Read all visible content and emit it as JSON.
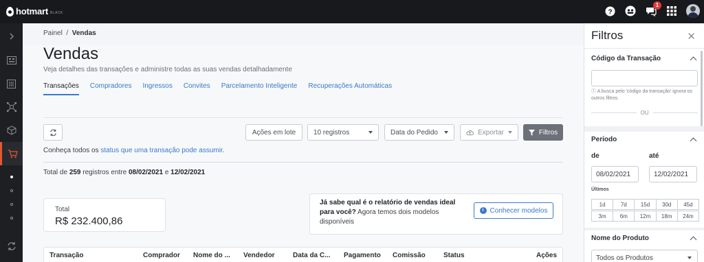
{
  "brand": {
    "name": "hotmart",
    "sub": "BLACK"
  },
  "topbar": {
    "notifications_count": "1"
  },
  "breadcrumb": {
    "root": "Painel",
    "current": "Vendas"
  },
  "page": {
    "title": "Vendas",
    "subtitle": "Veja detalhes das transações e administre todas as suas vendas detalhadamente"
  },
  "tabs": [
    "Transações",
    "Compradores",
    "Ingressos",
    "Convites",
    "Parcelamento Inteligente",
    "Recuperações Automáticas"
  ],
  "toolbar": {
    "bulk_actions": "Ações em lote",
    "per_page": "10 registros",
    "date_type": "Data do Pedido",
    "export": "Exportar",
    "filters": "Filtros"
  },
  "info": {
    "prefix": "Conheça todos os ",
    "link": "status que uma transação pode assumir",
    "suffix": "."
  },
  "summary": {
    "prefix": "Total de ",
    "count": "259",
    "middle": " registros entre ",
    "start": "08/02/2021",
    "and": " e ",
    "end": "12/02/2021"
  },
  "total_card": {
    "label": "Total",
    "value": "R$ 232.400,86"
  },
  "promo": {
    "bold": "Já sabe qual é o relatório de vendas ideal para você?",
    "text": " Agora temos dois modelos disponíveis",
    "button": "Conhecer modelos"
  },
  "table": {
    "columns": [
      "Transação",
      "Comprador",
      "Nome do ...",
      "Vendedor",
      "Data da C...",
      "Pagamento",
      "Comissão",
      "Status",
      "Ações"
    ]
  },
  "filters": {
    "title": "Filtros",
    "transaction_code": {
      "title": "Código da Transação",
      "value": "",
      "hint": "A busca pelo 'código da transação' ignora os outros filtros.",
      "or": "OU"
    },
    "period": {
      "title": "Período",
      "from_label": "de",
      "to_label": "até",
      "from": "08/02/2021",
      "to": "12/02/2021",
      "last_label": "Últimos",
      "row1": [
        "1d",
        "7d",
        "15d",
        "30d",
        "45d"
      ],
      "row2": [
        "3m",
        "6m",
        "12m",
        "18m",
        "24m"
      ]
    },
    "product": {
      "title": "Nome do Produto",
      "value": "Todos os Produtos"
    }
  }
}
